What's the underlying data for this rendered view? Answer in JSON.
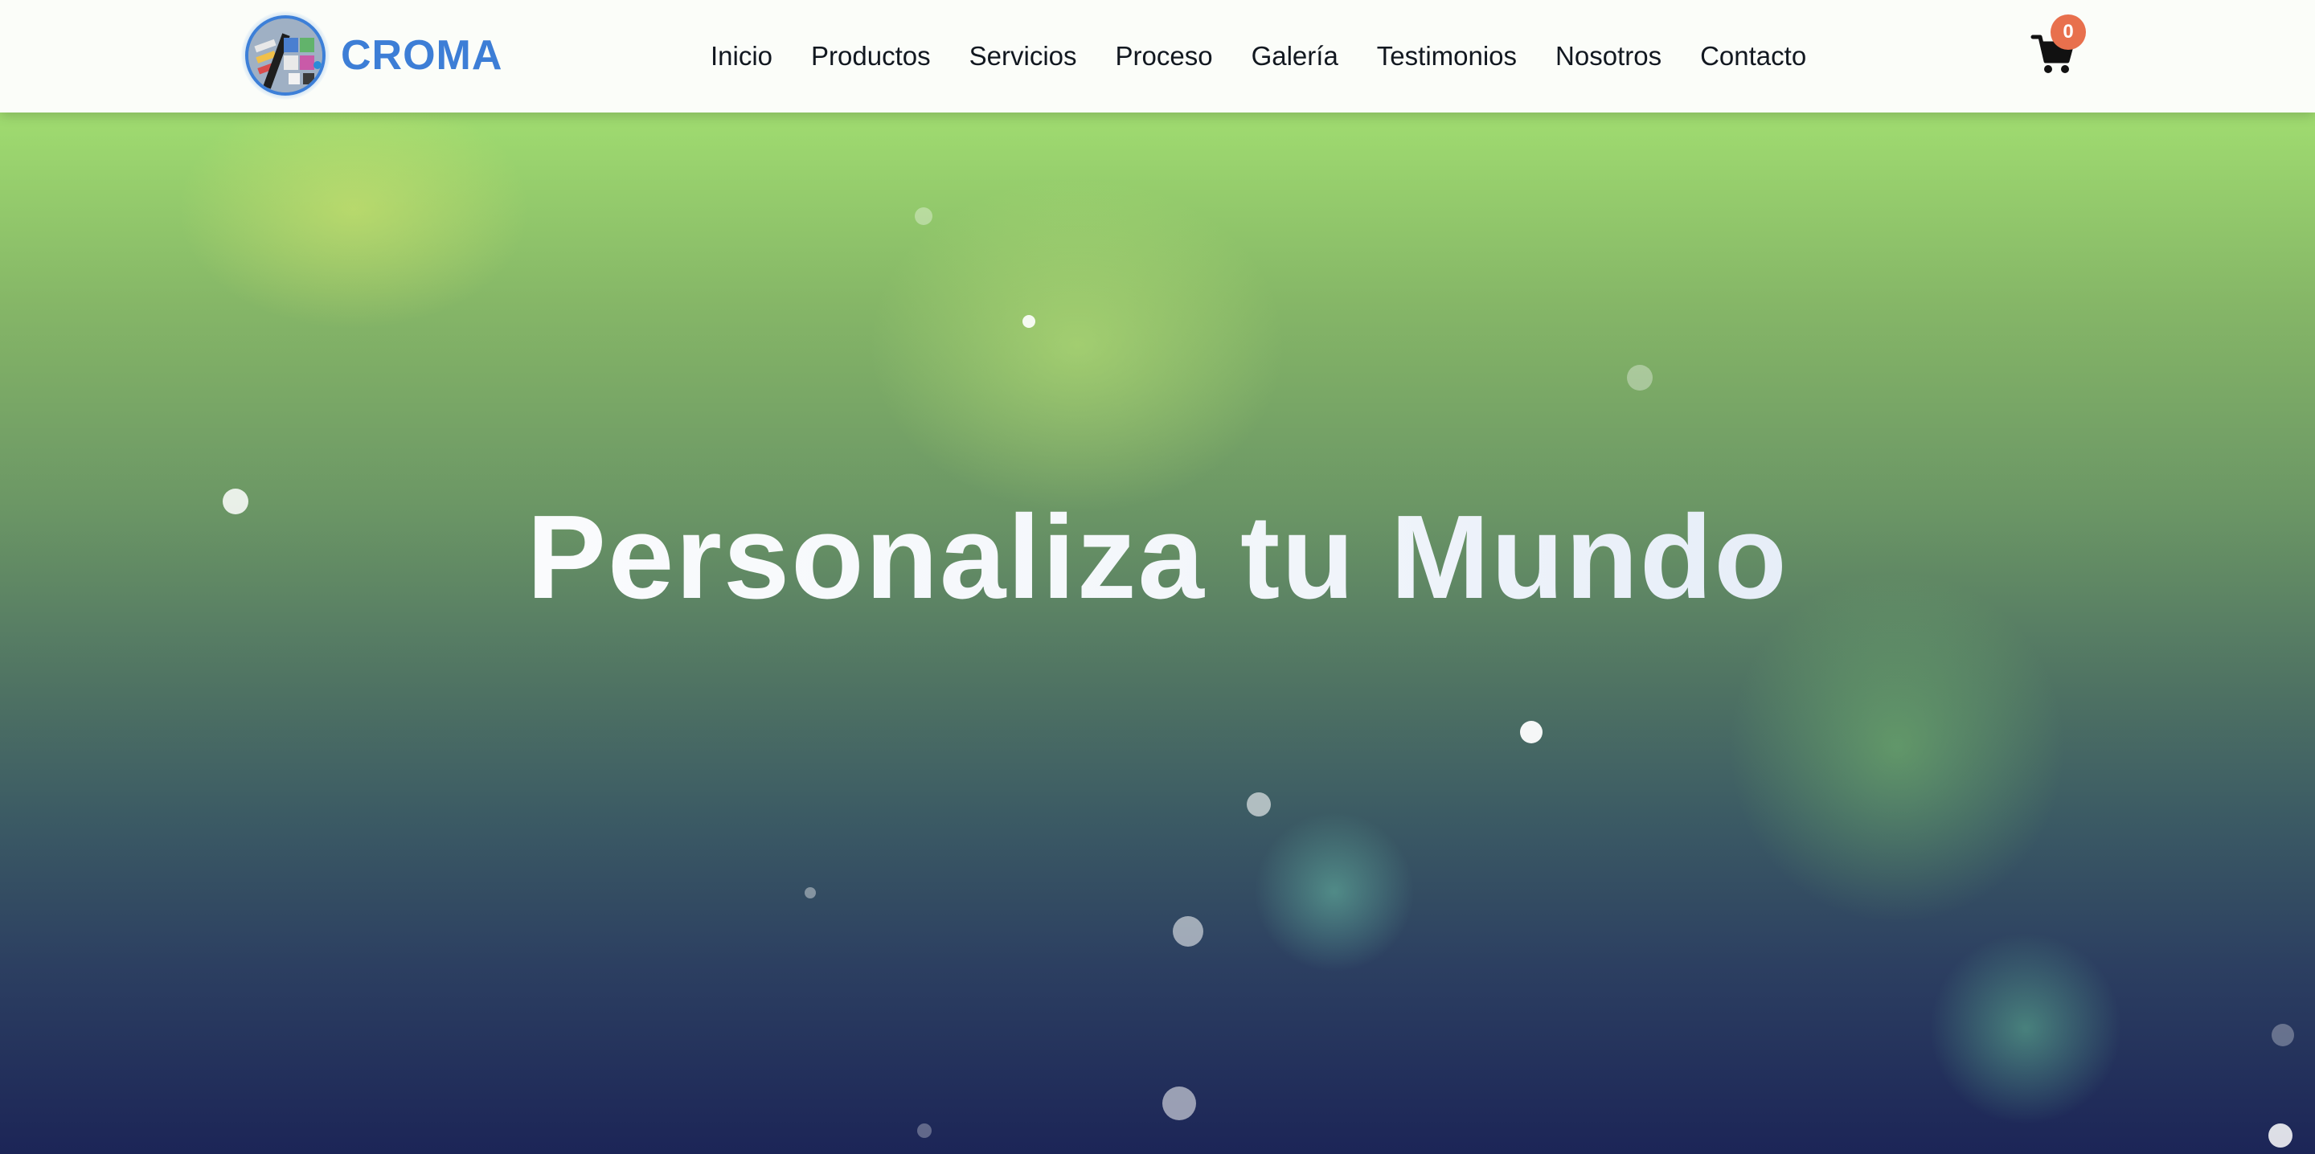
{
  "brand": {
    "name": "CROMA",
    "logo_icon": "croma-logo-icon",
    "accent_color": "#3d7ed6"
  },
  "nav": {
    "items": [
      {
        "label": "Inicio"
      },
      {
        "label": "Productos"
      },
      {
        "label": "Servicios"
      },
      {
        "label": "Proceso"
      },
      {
        "label": "Galería"
      },
      {
        "label": "Testimonios"
      },
      {
        "label": "Nosotros"
      },
      {
        "label": "Contacto"
      }
    ]
  },
  "cart": {
    "icon": "shopping-cart-icon",
    "count": "0",
    "badge_color": "#e8704d"
  },
  "hero": {
    "title": "Personaliza tu Mundo",
    "gradient_top": "#a0dc70",
    "gradient_bottom": "#1c2557"
  }
}
